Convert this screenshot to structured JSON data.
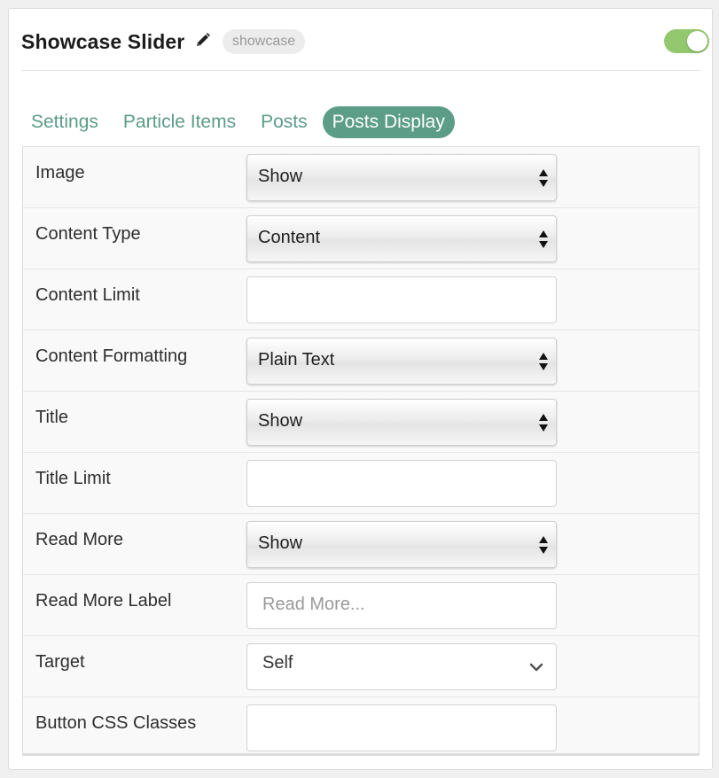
{
  "header": {
    "title": "Showcase Slider",
    "badge": "showcase",
    "edit_icon": "pencil-icon",
    "toggle_on": true,
    "toggle_color": "#94c86f"
  },
  "tabs": [
    {
      "label": "Settings",
      "active": false
    },
    {
      "label": "Particle Items",
      "active": false
    },
    {
      "label": "Posts",
      "active": false
    },
    {
      "label": "Posts Display",
      "active": true
    }
  ],
  "accent_color": "#5b9d86",
  "fields": {
    "image": {
      "label": "Image",
      "value": "Show"
    },
    "content_type": {
      "label": "Content Type",
      "value": "Content"
    },
    "content_limit": {
      "label": "Content Limit",
      "value": ""
    },
    "content_formatting": {
      "label": "Content Formatting",
      "value": "Plain Text"
    },
    "title": {
      "label": "Title",
      "value": "Show"
    },
    "title_limit": {
      "label": "Title Limit",
      "value": ""
    },
    "read_more": {
      "label": "Read More",
      "value": "Show"
    },
    "read_more_label": {
      "label": "Read More Label",
      "value": "",
      "placeholder": "Read More..."
    },
    "target": {
      "label": "Target",
      "value": "Self"
    },
    "button_css_classes": {
      "label": "Button CSS Classes",
      "value": ""
    }
  }
}
